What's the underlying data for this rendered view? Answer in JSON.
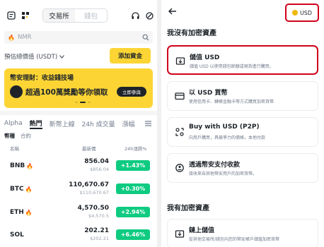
{
  "left": {
    "segments": [
      "交易所",
      "錢包"
    ],
    "search_placeholder": "NMR",
    "estimated_label": "預估總價值 (USDT)",
    "deposit_label": "添加資金",
    "banner": {
      "title": "幣安理財：收益錢技場",
      "headline": "超過100萬獎勵等你領取",
      "cta": "立即參與"
    },
    "market_tabs": [
      "Alpha",
      "熱門",
      "新幣上線",
      "24h 成交量",
      "漲幅"
    ],
    "sub_tabs": [
      "幣種",
      "合約"
    ],
    "headers": {
      "name": "名稱",
      "price": "最新價",
      "change": "24h漲跌%"
    },
    "rows": [
      {
        "symbol": "BNB",
        "price": "856.04",
        "fiat": "$856.04",
        "change": "+1.43%"
      },
      {
        "symbol": "BTC",
        "price": "110,670.67",
        "fiat": "$110,670.67",
        "change": "+0.30%"
      },
      {
        "symbol": "ETH",
        "price": "4,570.50",
        "fiat": "$4,570.5",
        "change": "+2.94%"
      },
      {
        "symbol": "SOL",
        "price": "202.21",
        "fiat": "$202.21",
        "change": "+6.46%"
      }
    ]
  },
  "right": {
    "currency": "USD",
    "section_no_crypto": "我沒有加密資產",
    "section_have_crypto": "我有加密資產",
    "options": [
      {
        "title": "儲值 USD",
        "desc": "儲值 USD 以使用錢包餘額或現貨進行購買。"
      },
      {
        "title": "以 USD 買幣",
        "desc": "使用信用卡、轉帳金融卡等方式購買加密貨幣"
      },
      {
        "title": "Buy with USD (P2P)",
        "desc": "向用戶購買，具競爭力的價格，本地付款"
      },
      {
        "title": "透過幣安支付收款",
        "desc": "接收來自其他幣安用戶的加密貨幣。"
      },
      {
        "title": "鏈上儲值",
        "desc": "從其他交易所/錢包向您的幣安帳戶儲值加密貨幣"
      }
    ]
  },
  "colors": {
    "accent": "#fcd535",
    "up": "#0ecb81",
    "highlight": "#d0021b"
  }
}
